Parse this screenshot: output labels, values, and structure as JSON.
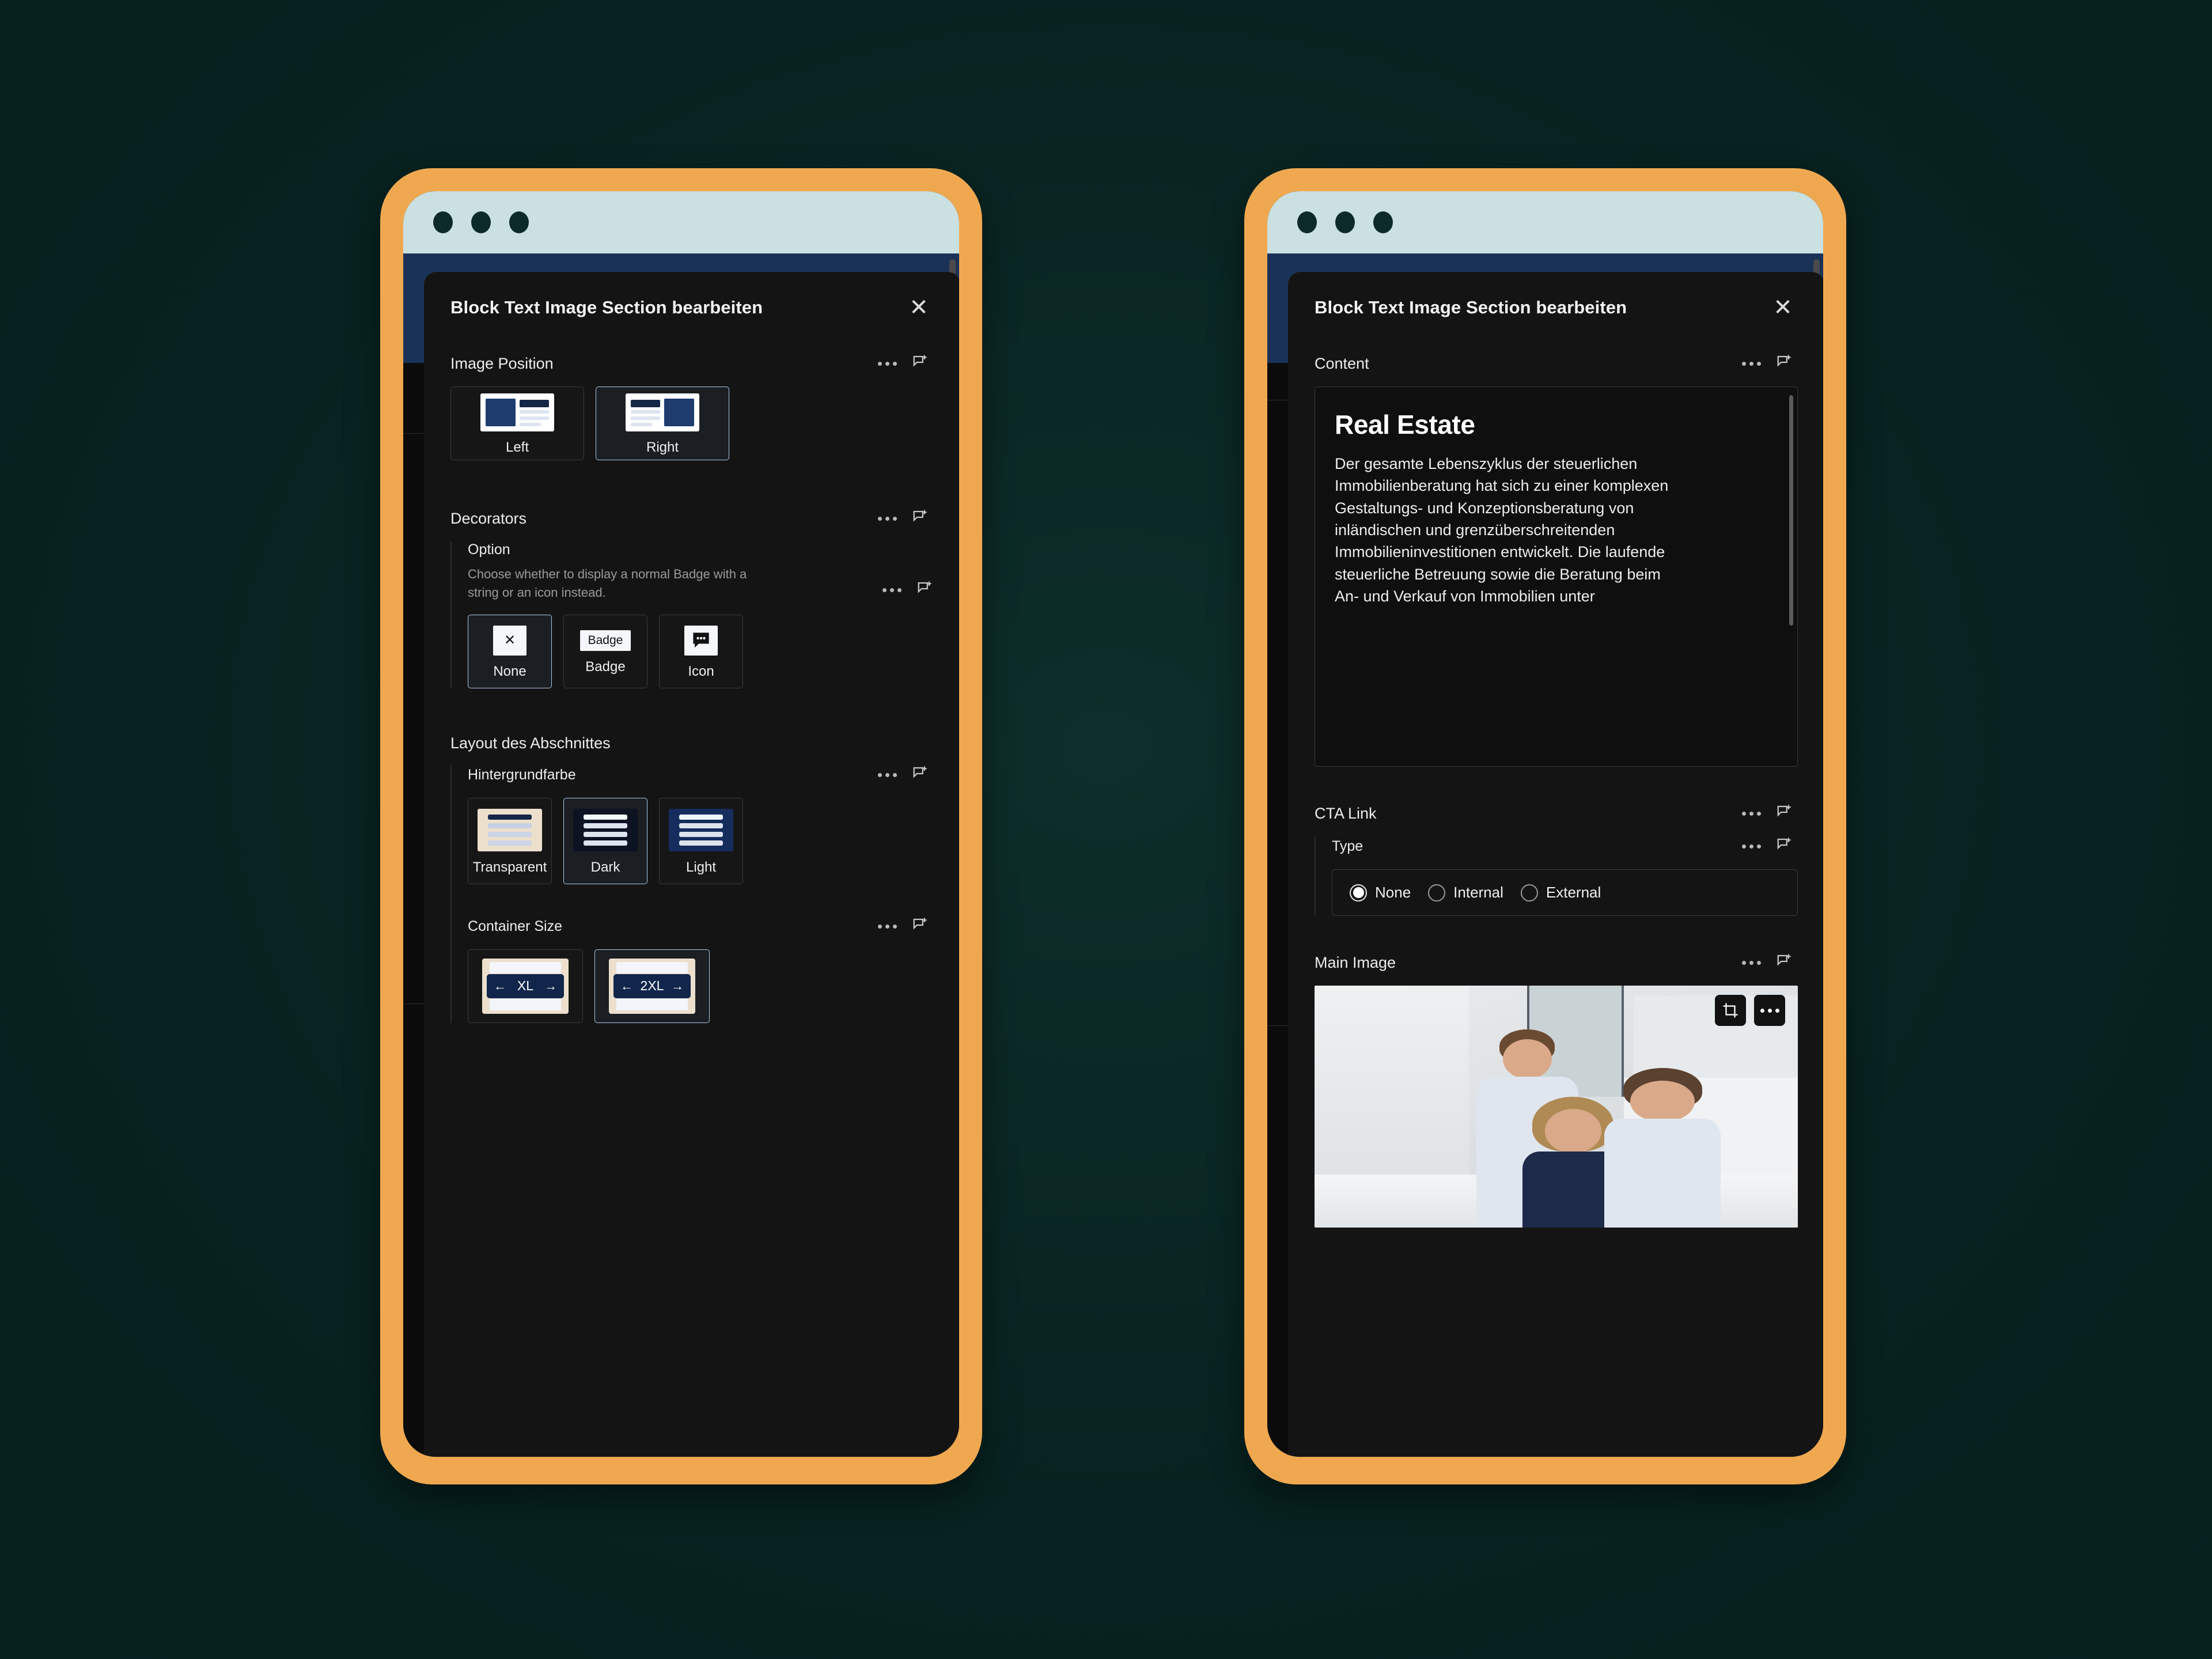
{
  "dialog": {
    "title": "Block Text Image Section bearbeiten",
    "close_label": "✕"
  },
  "left_phone": {
    "sections": {
      "image_position": {
        "title": "Image Position",
        "options": [
          {
            "label": "Left",
            "selected": false
          },
          {
            "label": "Right",
            "selected": true
          }
        ]
      },
      "decorators": {
        "title": "Decorators",
        "option": {
          "title": "Option",
          "description": "Choose whether to display a normal Badge with a string or an icon instead.",
          "options": [
            {
              "label": "None",
              "thumb_text": "✕",
              "selected": true
            },
            {
              "label": "Badge",
              "thumb_text": "Badge",
              "selected": false
            },
            {
              "label": "Icon",
              "thumb_text": "",
              "selected": false
            }
          ]
        }
      },
      "layout": {
        "title": "Layout des Abschnittes",
        "background_color": {
          "title": "Hintergrundfarbe",
          "options": [
            {
              "label": "Transparent",
              "selected": false
            },
            {
              "label": "Dark",
              "selected": true
            },
            {
              "label": "Light",
              "selected": false
            }
          ]
        },
        "container_size": {
          "title": "Container Size",
          "options": [
            {
              "label": "XL",
              "selected": false
            },
            {
              "label": "2XL",
              "selected": true
            }
          ]
        }
      }
    }
  },
  "right_phone": {
    "sections": {
      "content": {
        "title": "Content",
        "heading": "Real Estate",
        "body": "Der gesamte Lebenszyklus der steuerlichen Immobilienberatung hat sich zu einer komplexen Gestaltungs- und Konzeptionsberatung von inländischen und grenzüberschreitenden Immobilieninvestitionen entwickelt. Die laufende steuerliche Betreuung sowie die Beratung beim An- und Verkauf von Immobilien unter"
      },
      "cta_link": {
        "title": "CTA Link",
        "type": {
          "title": "Type",
          "options": [
            {
              "label": "None",
              "selected": true
            },
            {
              "label": "Internal",
              "selected": false
            },
            {
              "label": "External",
              "selected": false
            }
          ]
        }
      },
      "main_image": {
        "title": "Main Image",
        "tools": [
          "crop-icon",
          "more-icon"
        ]
      }
    }
  },
  "icons": {
    "more": "more-icon",
    "comment_add": "comment-add-icon",
    "crop": "crop-icon",
    "chat_bubble": "chat-bubble-icon"
  },
  "colors": {
    "frame": "#efa850",
    "chrome": "#cbe0e0",
    "page_blue": "#1b3258",
    "dialog_bg": "#141414",
    "accent_selected": "#aecbe8",
    "brand_navy": "#1e3c6e",
    "transparent_swatch": "#ece0cd"
  }
}
